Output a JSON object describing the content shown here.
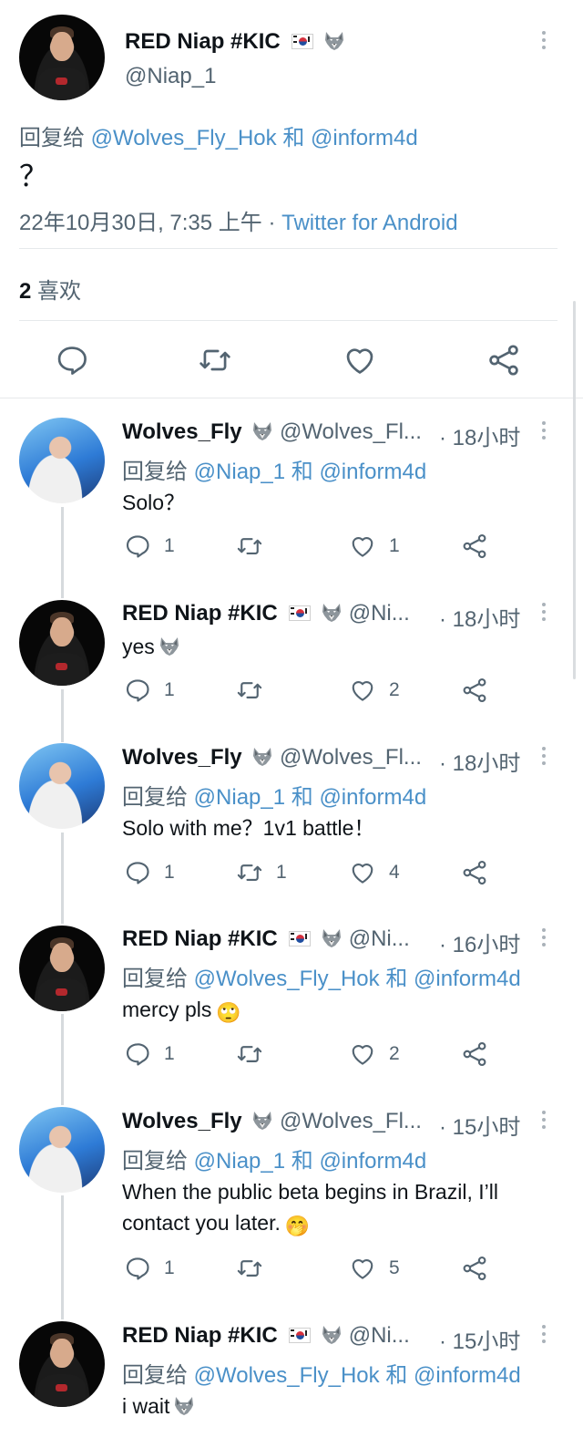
{
  "main_tweet": {
    "name": "RED Niap #KIC",
    "handle": "@Niap_1",
    "reply_prefix": "回复给",
    "reply_to_1": "@Wolves_Fly_Hok",
    "reply_and": "和",
    "reply_to_2": "@inform4d",
    "text": "？",
    "timestamp": "22年10月30日, 7:35 上午 ·",
    "source": "Twitter for Android",
    "likes_count": "2",
    "likes_label": "喜欢"
  },
  "replies": [
    {
      "name": "Wolves_Fly",
      "handle": "@Wolves_Fl...",
      "time": "· 18小时",
      "reply_prefix": "回复给",
      "reply_to_1": "@Niap_1",
      "reply_and": "和",
      "reply_to_2": "@inform4d",
      "text": "Solo？",
      "reply_count": "1",
      "retweet_count": "",
      "like_count": "1"
    },
    {
      "name": "RED Niap #KIC",
      "handle": "@Ni...",
      "time": "· 18小时",
      "text": "yes",
      "reply_count": "1",
      "retweet_count": "",
      "like_count": "2"
    },
    {
      "name": "Wolves_Fly",
      "handle": "@Wolves_Fl...",
      "time": "· 18小时",
      "reply_prefix": "回复给",
      "reply_to_1": "@Niap_1",
      "reply_and": "和",
      "reply_to_2": "@inform4d",
      "text": "Solo with me？1v1 battle！",
      "reply_count": "1",
      "retweet_count": "1",
      "like_count": "4"
    },
    {
      "name": "RED Niap #KIC",
      "handle": "@Ni...",
      "time": "· 16小时",
      "reply_prefix": "回复给",
      "reply_to_1": "@Wolves_Fly_Hok",
      "reply_and": "和",
      "reply_to_2": "@inform4d",
      "text": "mercy pls",
      "reply_count": "1",
      "retweet_count": "",
      "like_count": "2"
    },
    {
      "name": "Wolves_Fly",
      "handle": "@Wolves_Fl...",
      "time": "· 15小时",
      "reply_prefix": "回复给",
      "reply_to_1": "@Niap_1",
      "reply_and": "和",
      "reply_to_2": "@inform4d",
      "text_line1": "When the public beta begins in Brazil, I’ll",
      "text_line2": "contact you later.",
      "reply_count": "1",
      "retweet_count": "",
      "like_count": "5"
    },
    {
      "name": "RED Niap #KIC",
      "handle": "@Ni...",
      "time": "· 15小时",
      "reply_prefix": "回复给",
      "reply_to_1": "@Wolves_Fly_Hok",
      "reply_and": "和",
      "reply_to_2": "@inform4d",
      "text": "i wait"
    }
  ],
  "colors": {
    "link": "#4a90c8",
    "text": "#0f1419",
    "secondary": "#536471",
    "divider": "#e6e9eb"
  },
  "icons": [
    "more-icon",
    "reply-icon",
    "retweet-icon",
    "like-icon",
    "share-icon",
    "korea-flag-icon",
    "wolf-emoji-icon",
    "rolling-eyes-emoji-icon",
    "hand-over-mouth-emoji-icon"
  ]
}
